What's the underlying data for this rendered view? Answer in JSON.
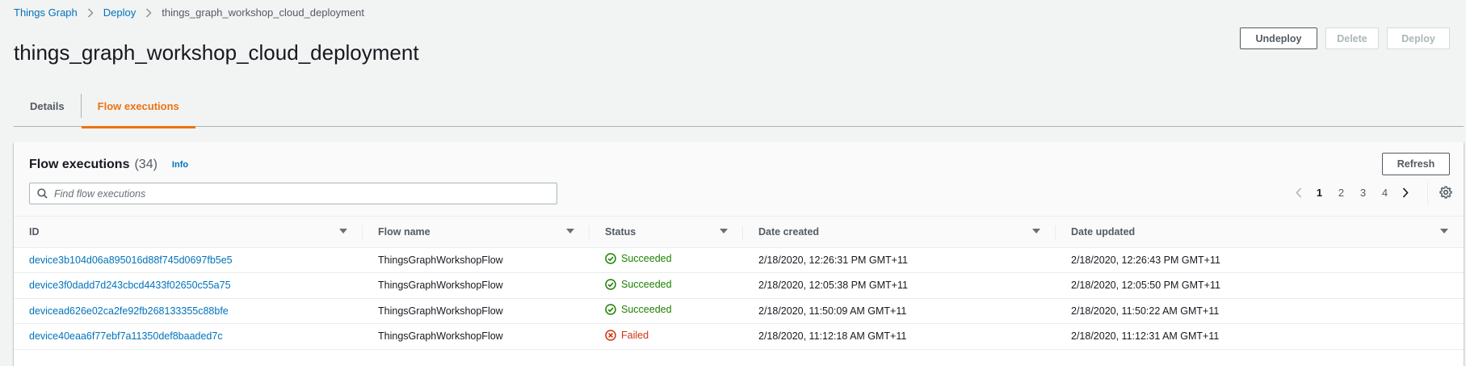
{
  "breadcrumb": {
    "items": [
      "Things Graph",
      "Deploy"
    ],
    "current": "things_graph_workshop_cloud_deployment"
  },
  "page_title": "things_graph_workshop_cloud_deployment",
  "actions": {
    "undeploy": "Undeploy",
    "delete": "Delete",
    "deploy": "Deploy"
  },
  "tabs": [
    {
      "label": "Details",
      "active": false
    },
    {
      "label": "Flow executions",
      "active": true
    }
  ],
  "panel": {
    "title": "Flow executions",
    "count": "(34)",
    "info": "Info",
    "refresh": "Refresh",
    "search_placeholder": "Find flow executions"
  },
  "pagination": {
    "pages": [
      "1",
      "2",
      "3",
      "4"
    ],
    "current": "1"
  },
  "table": {
    "columns": [
      "ID",
      "Flow name",
      "Status",
      "Date created",
      "Date updated"
    ],
    "rows": [
      {
        "id": "device3b104d06a895016d88f745d0697fb5e5",
        "flow_name": "ThingsGraphWorkshopFlow",
        "status": "Succeeded",
        "created": "2/18/2020, 12:26:31 PM GMT+11",
        "updated": "2/18/2020, 12:26:43 PM GMT+11"
      },
      {
        "id": "device3f0dadd7d243cbcd4433f02650c55a75",
        "flow_name": "ThingsGraphWorkshopFlow",
        "status": "Succeeded",
        "created": "2/18/2020, 12:05:38 PM GMT+11",
        "updated": "2/18/2020, 12:05:50 PM GMT+11"
      },
      {
        "id": "devicead626e02ca2fe92fb268133355c88bfe",
        "flow_name": "ThingsGraphWorkshopFlow",
        "status": "Succeeded",
        "created": "2/18/2020, 11:50:09 AM GMT+11",
        "updated": "2/18/2020, 11:50:22 AM GMT+11"
      },
      {
        "id": "device40eaa6f77ebf7a11350def8baaded7c",
        "flow_name": "ThingsGraphWorkshopFlow",
        "status": "Failed",
        "created": "2/18/2020, 11:12:18 AM GMT+11",
        "updated": "2/18/2020, 11:12:31 AM GMT+11"
      }
    ]
  },
  "colors": {
    "link": "#0073bb",
    "accent": "#ec7211",
    "success": "#1d8102",
    "error": "#d13212"
  }
}
